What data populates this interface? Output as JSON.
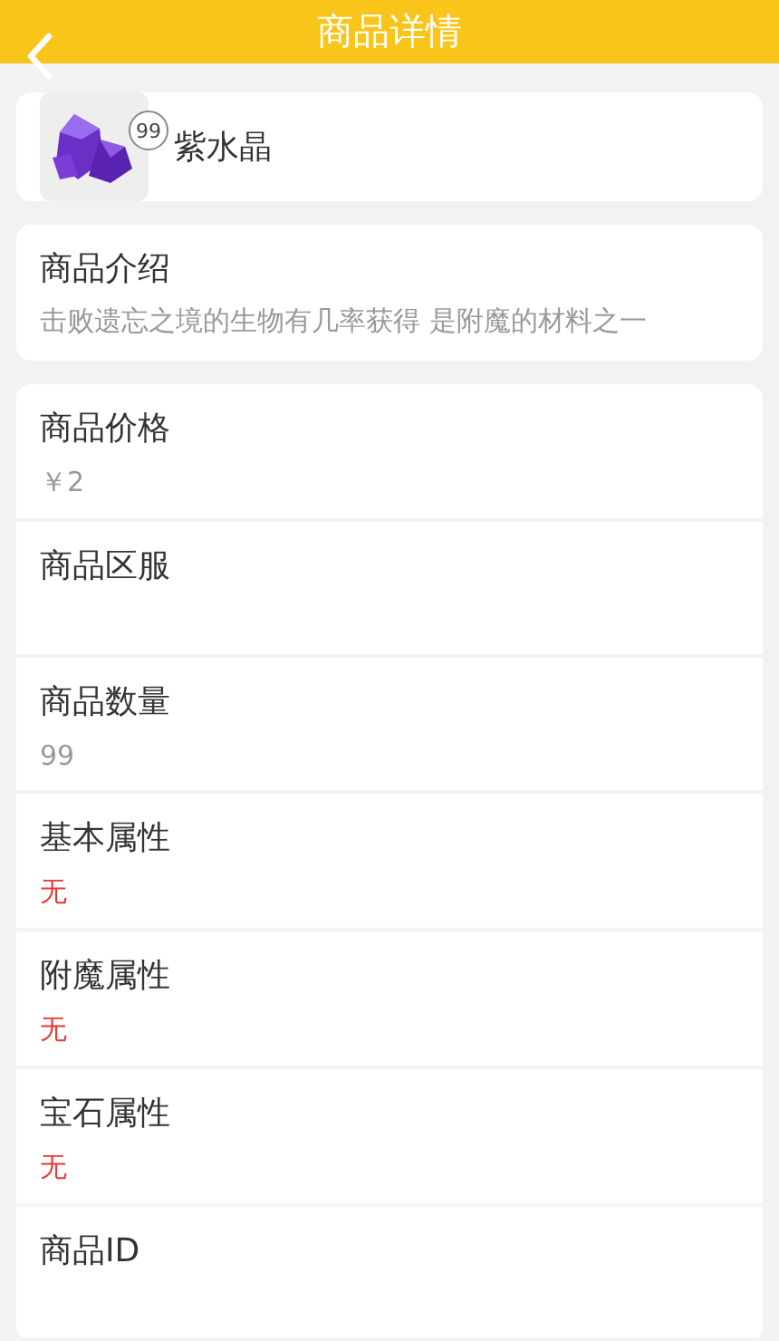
{
  "header": {
    "title": "商品详情"
  },
  "item": {
    "name": "紫水晶",
    "count": "99"
  },
  "description": {
    "label": "商品介绍",
    "text": "击败遗忘之境的生物有几率获得 是附魔的材料之一"
  },
  "fields": [
    {
      "label": "商品价格",
      "value": "￥2",
      "kind": "text"
    },
    {
      "label": "商品区服",
      "kind": "blank"
    },
    {
      "label": "商品数量",
      "value": "99",
      "kind": "text"
    },
    {
      "label": "基本属性",
      "value": "无",
      "kind": "missing"
    },
    {
      "label": "附魔属性",
      "value": "无",
      "kind": "missing"
    },
    {
      "label": "宝石属性",
      "value": "无",
      "kind": "missing"
    },
    {
      "label": "商品ID",
      "kind": "cut"
    }
  ]
}
